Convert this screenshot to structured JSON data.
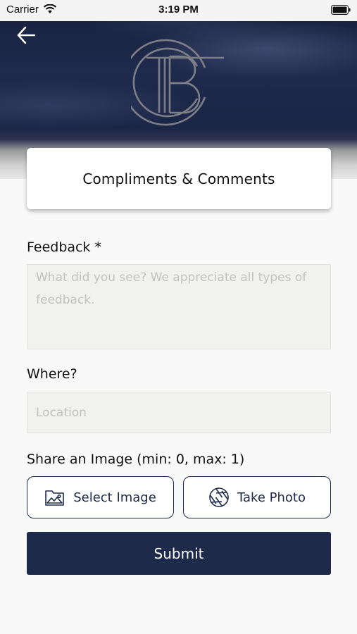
{
  "status_bar": {
    "carrier": "Carrier",
    "time": "3:19 PM"
  },
  "header": {
    "back_icon": "arrow-left-icon",
    "logo_icon": "tbc-monogram-logo"
  },
  "page": {
    "title": "Compliments & Comments"
  },
  "form": {
    "feedback": {
      "label": "Feedback *",
      "placeholder": "What did you see? We appreciate all types of feedback.",
      "value": ""
    },
    "where": {
      "label": "Where?",
      "placeholder": "Location",
      "value": ""
    },
    "image": {
      "label": "Share an Image (min: 0, max: 1)",
      "select_label": "Select Image",
      "select_icon": "image-icon",
      "photo_label": "Take Photo",
      "photo_icon": "camera-aperture-icon"
    },
    "submit_label": "Submit"
  },
  "colors": {
    "brand_navy": "#1e2a4a",
    "field_background": "#f1f1ef",
    "page_background": "#f9f9f9"
  }
}
